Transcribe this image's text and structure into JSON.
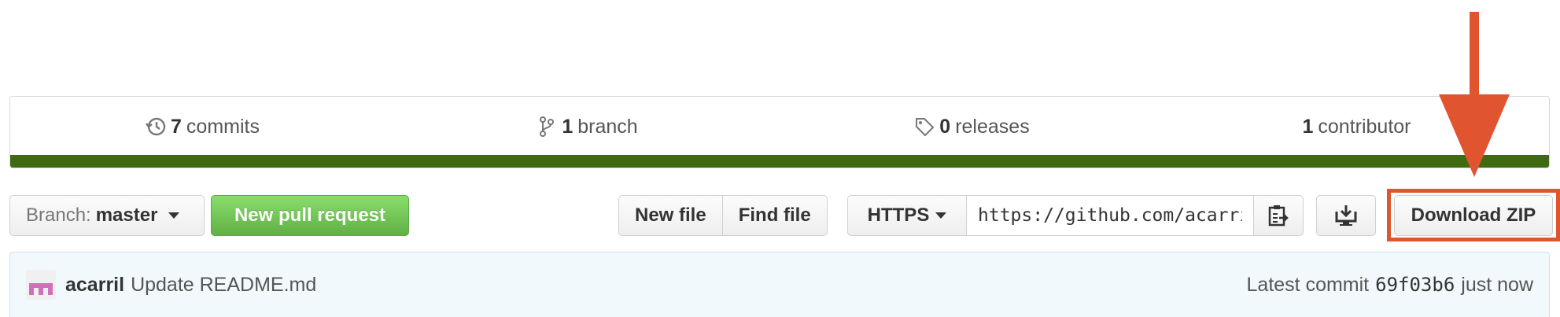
{
  "summary": {
    "commits": {
      "count": "7",
      "label": "commits",
      "icon": "history-icon"
    },
    "branches": {
      "count": "1",
      "label": "branch",
      "icon": "git-branch-icon"
    },
    "releases": {
      "count": "0",
      "label": "releases",
      "icon": "tag-icon"
    },
    "contributors": {
      "count": "1",
      "label": "contributor"
    },
    "language_bar_color": "#3f6a10"
  },
  "toolbar": {
    "branch_prefix": "Branch:",
    "branch_name": "master",
    "new_pull_request": "New pull request",
    "new_file": "New file",
    "find_file": "Find file",
    "clone_protocol": "HTTPS",
    "clone_url": "https://github.com/acarril/",
    "copy_icon": "clipboard-icon",
    "desktop_icon": "desktop-download-icon",
    "download_zip": "Download ZIP"
  },
  "annotation": {
    "arrow_color": "#e05530",
    "highlight_color": "#e05530"
  },
  "commit": {
    "author": "acarril",
    "message": "Update README.md",
    "latest_label": "Latest commit",
    "sha": "69f03b6",
    "time": "just now"
  }
}
